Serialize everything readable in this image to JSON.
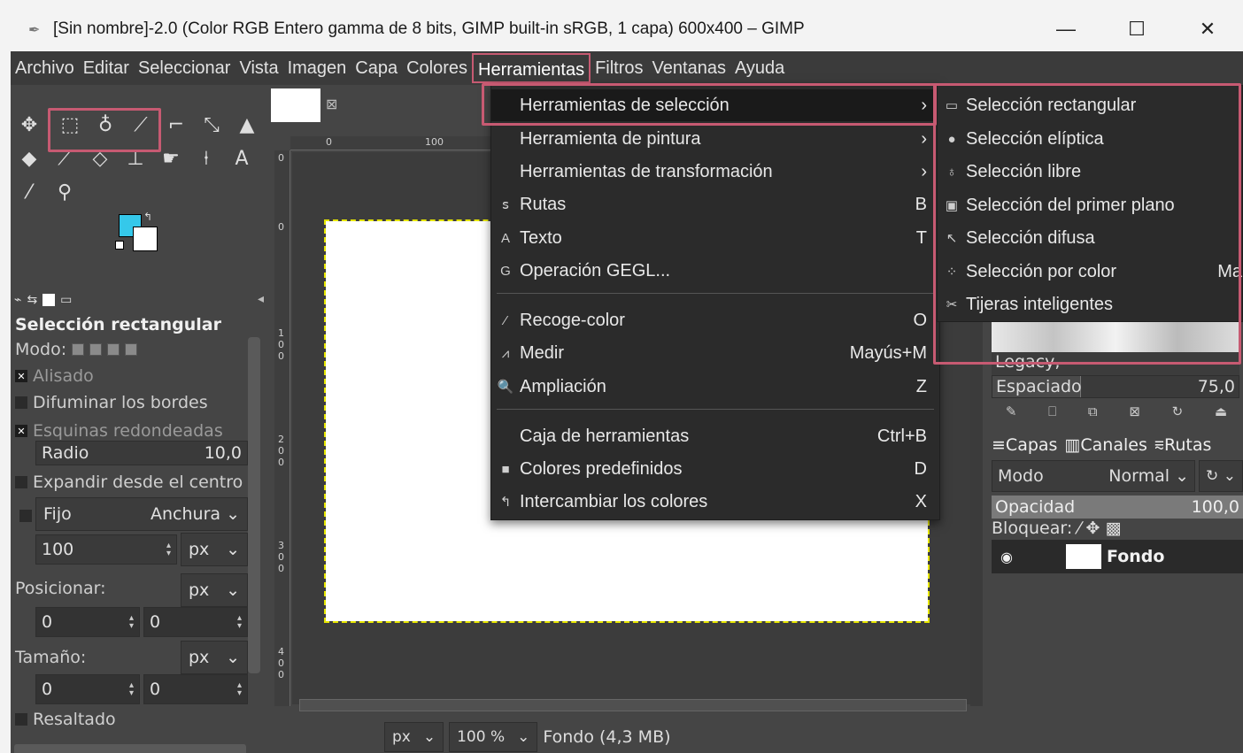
{
  "window": {
    "title": "[Sin nombre]-2.0 (Color RGB Entero gamma de 8 bits, GIMP built-in sRGB, 1 capa) 600x400 – GIMP",
    "minimize": "—",
    "maximize": "☐",
    "close": "✕"
  },
  "menubar": [
    "Archivo",
    "Editar",
    "Seleccionar",
    "Vista",
    "Imagen",
    "Capa",
    "Colores",
    "Herramientas",
    "Filtros",
    "Ventanas",
    "Ayuda"
  ],
  "tool_options": {
    "title": "Selección rectangular",
    "mode_label": "Modo:",
    "antialias": "Alisado",
    "feather": "Difuminar los bordes",
    "rounded": "Esquinas redondeadas",
    "radius_label": "Radio",
    "radius_value": "10,0",
    "expand": "Expandir desde el centro",
    "fixed": "Fijo",
    "fixed_mode": "Anchura",
    "fixed_value": "100",
    "unit": "px",
    "position_label": "Posicionar:",
    "pos_x": "0",
    "pos_y": "0",
    "size_label": "Tamaño:",
    "size_x": "0",
    "size_y": "0",
    "highlight": "Resaltado"
  },
  "ruler": {
    "h0": "0",
    "h100": "100",
    "v0": "0",
    "v1": "1 0 0",
    "v2": "2 0 0",
    "v3": "3 0 0",
    "v4": "4 0 0"
  },
  "statusbar": {
    "unit": "px",
    "zoom": "100 %",
    "info": "Fondo (4,3 MB)"
  },
  "menu_tools": [
    {
      "icon": "",
      "label": "Herramientas de selección",
      "acc": "›"
    },
    {
      "icon": "",
      "label": "Herramienta de pintura",
      "acc": "›"
    },
    {
      "icon": "",
      "label": "Herramientas de transformación",
      "acc": "›"
    },
    {
      "icon": "ꜱ",
      "label": "Rutas",
      "acc": "B"
    },
    {
      "icon": "A",
      "label": "Texto",
      "acc": "T"
    },
    {
      "icon": "G",
      "label": "Operación GEGL...",
      "acc": ""
    },
    {
      "icon": "⁄",
      "label": "Recoge-color",
      "acc": "O"
    },
    {
      "icon": "⩘",
      "label": "Medir",
      "acc": "Mayús+M"
    },
    {
      "icon": "🔍",
      "label": "Ampliación",
      "acc": "Z"
    },
    {
      "icon": "",
      "label": "Caja de herramientas",
      "acc": "Ctrl+B"
    },
    {
      "icon": "■",
      "label": "Colores predefinidos",
      "acc": "D"
    },
    {
      "icon": "↰",
      "label": "Intercambiar los colores",
      "acc": "X"
    }
  ],
  "menu_selection": [
    {
      "icon": "▭",
      "label": "Selección rectangular",
      "acc": ""
    },
    {
      "icon": "●",
      "label": "Selección elíptica",
      "acc": ""
    },
    {
      "icon": "♁",
      "label": "Selección libre",
      "acc": ""
    },
    {
      "icon": "▣",
      "label": "Selección del primer plano",
      "acc": ""
    },
    {
      "icon": "↖",
      "label": "Selección difusa",
      "acc": ""
    },
    {
      "icon": "⁘",
      "label": "Selección por color",
      "acc": "Ma"
    },
    {
      "icon": "✂",
      "label": "Tijeras inteligentes",
      "acc": ""
    }
  ],
  "right_dock": {
    "brush_name": "Legacy,",
    "spacing_label": "Espaciado",
    "spacing_value": "75,0",
    "tabs": [
      "Capas",
      "Canales",
      "Rutas"
    ],
    "mode_label": "Modo",
    "mode_value": "Normal",
    "opacity_label": "Opacidad",
    "opacity_value": "100,0",
    "lock_label": "Bloquear:",
    "layer_name": "Fondo"
  },
  "colors": {
    "accent_highlight": "#c75a72",
    "foreground": "#35c8ea",
    "background": "#ffffff"
  }
}
